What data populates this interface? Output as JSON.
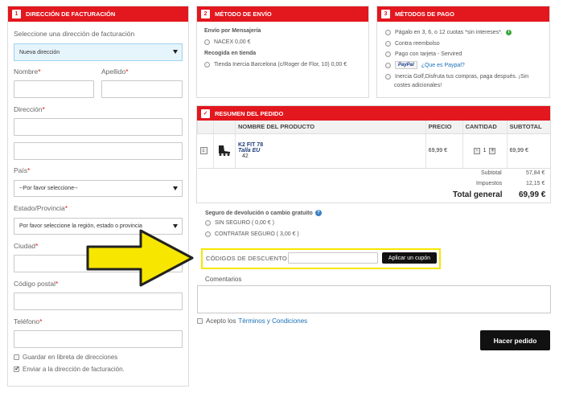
{
  "billing": {
    "num": "1",
    "title": "DIRECCIÓN DE FACTURACIÓN",
    "select_label": "Seleccione una dirección de facturación",
    "address_select": "Nueva dirección",
    "nombre": "Nombre",
    "apellido": "Apellido",
    "direccion": "Dirección",
    "pais": "País",
    "pais_select": "--Por favor seleccione--",
    "estado": "Estado/Provincia",
    "estado_select": "Por favor seleccione la región, estado o provincia",
    "ciudad": "Ciudad",
    "codigo_postal": "Código postal",
    "telefono": "Teléfono",
    "guardar": "Guardar en libreta de direcciones",
    "enviar": "Enviar a la dirección de facturación.",
    "req": "*"
  },
  "shipping": {
    "num": "2",
    "title": "MÉTODO DE ENVÍO",
    "group1": "Envío por Mensajería",
    "opt1": "NACEX 0,00 €",
    "group2": "Recogida en tienda",
    "opt2": "Tienda Inercia Barcelona (c/Roger de Flor, 10) 0,00 €"
  },
  "payment": {
    "num": "3",
    "title": "MÉTODOS DE PAGO",
    "opt1": "Págalo en 3, 6, o 12 cuotas *sin intereses*.",
    "opt2": "Contra reembolso",
    "opt3": "Pago con tarjeta - Servired",
    "paypal_logo": "PayPal",
    "paypal_link": "¿Que es Paypal?",
    "opt5a": "Inercia Golf,Disfruta tus compras, paga después. ¡Sin",
    "opt5b": "costes adicionales!"
  },
  "summary": {
    "title": "RESUMEN DEL PEDIDO",
    "columns": [
      "NOMBRE DEL PRODUCTO",
      "PRECIO",
      "CANTIDAD",
      "SUBTOTAL"
    ],
    "product": {
      "name": "K2 FIT 78",
      "size_label": "Talla EU",
      "size": "42",
      "price": "69,99 €",
      "qty": "1",
      "subtotal": "69,99 €"
    },
    "subtotal_label": "Subtotal",
    "subtotal_value": "57,84 €",
    "tax_label": "Impuestos",
    "tax_value": "12,15 €",
    "total_label": "Total general",
    "total_value": "69,99 €",
    "insurance_title": "Seguro de devolución o cambio gratuito",
    "ins_opt1": "SIN SEGURO ( 0,00 € )",
    "ins_opt2": "CONTRATAR SEGURO ( 3,00 € )",
    "discount_label": "CÓDIGOS DE DESCUENTO",
    "discount_value": "",
    "apply_button": "Aplicar un cupón",
    "comments_label": "Comentarios",
    "accept_text": "Acepto los",
    "terms_link": "Términos y Condiciones",
    "order_button": "Hacer pedido"
  },
  "colors": {
    "brand_red": "#e3171e",
    "highlight_yellow": "#f7e600",
    "select_blue": "#e6f4fb"
  }
}
